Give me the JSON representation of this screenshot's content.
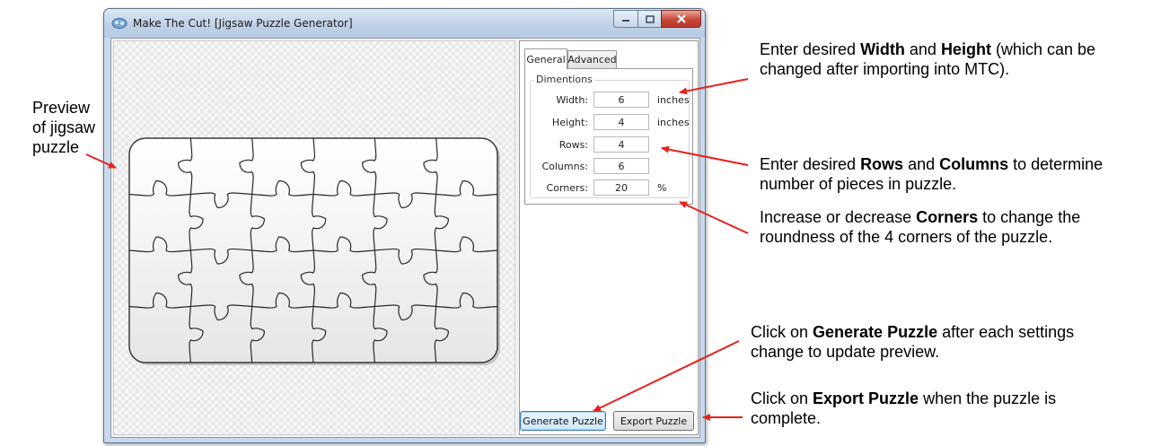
{
  "window": {
    "title": "Make The Cut! [Jigsaw Puzzle Generator]",
    "controls": [
      "minimize",
      "maximize",
      "close"
    ]
  },
  "tabs": [
    {
      "label": "General",
      "active": true
    },
    {
      "label": "Advanced",
      "active": false
    }
  ],
  "dimensions": {
    "legend": "Dimentions",
    "fields": [
      {
        "label": "Width:",
        "value": "6",
        "unit": "inches"
      },
      {
        "label": "Height:",
        "value": "4",
        "unit": "inches"
      },
      {
        "label": "Rows:",
        "value": "4",
        "unit": ""
      },
      {
        "label": "Columns:",
        "value": "6",
        "unit": ""
      },
      {
        "label": "Corners:",
        "value": "20",
        "unit": "%"
      }
    ]
  },
  "buttons": {
    "generate": "Generate Puzzle",
    "export": "Export Puzzle"
  },
  "puzzle": {
    "rows": 4,
    "columns": 6
  },
  "annotations": {
    "preview": "Preview of jigsaw puzzle",
    "size": {
      "pre": "Enter desired ",
      "b1": "Width",
      "mid": " and ",
      "b2": "Height",
      "post": " (which can be changed after importing into MTC)."
    },
    "rows_cols": {
      "pre": "Enter desired ",
      "b1": "Rows",
      "mid": " and ",
      "b2": "Columns",
      "post": " to determine number of pieces in puzzle."
    },
    "corners": {
      "pre": "Increase or decrease ",
      "b1": "Corners",
      "post": "  to change the roundness of the 4 corners of the puzzle."
    },
    "generate": {
      "pre": "Click on ",
      "b1": "Generate Puzzle",
      "post": " after each settings change to update preview."
    },
    "export": {
      "pre": "Click on ",
      "b1": "Export Puzzle",
      "post": " when the puzzle is complete."
    }
  },
  "colors": {
    "arrow": "#e8201c",
    "close_button": "#c9473a"
  }
}
